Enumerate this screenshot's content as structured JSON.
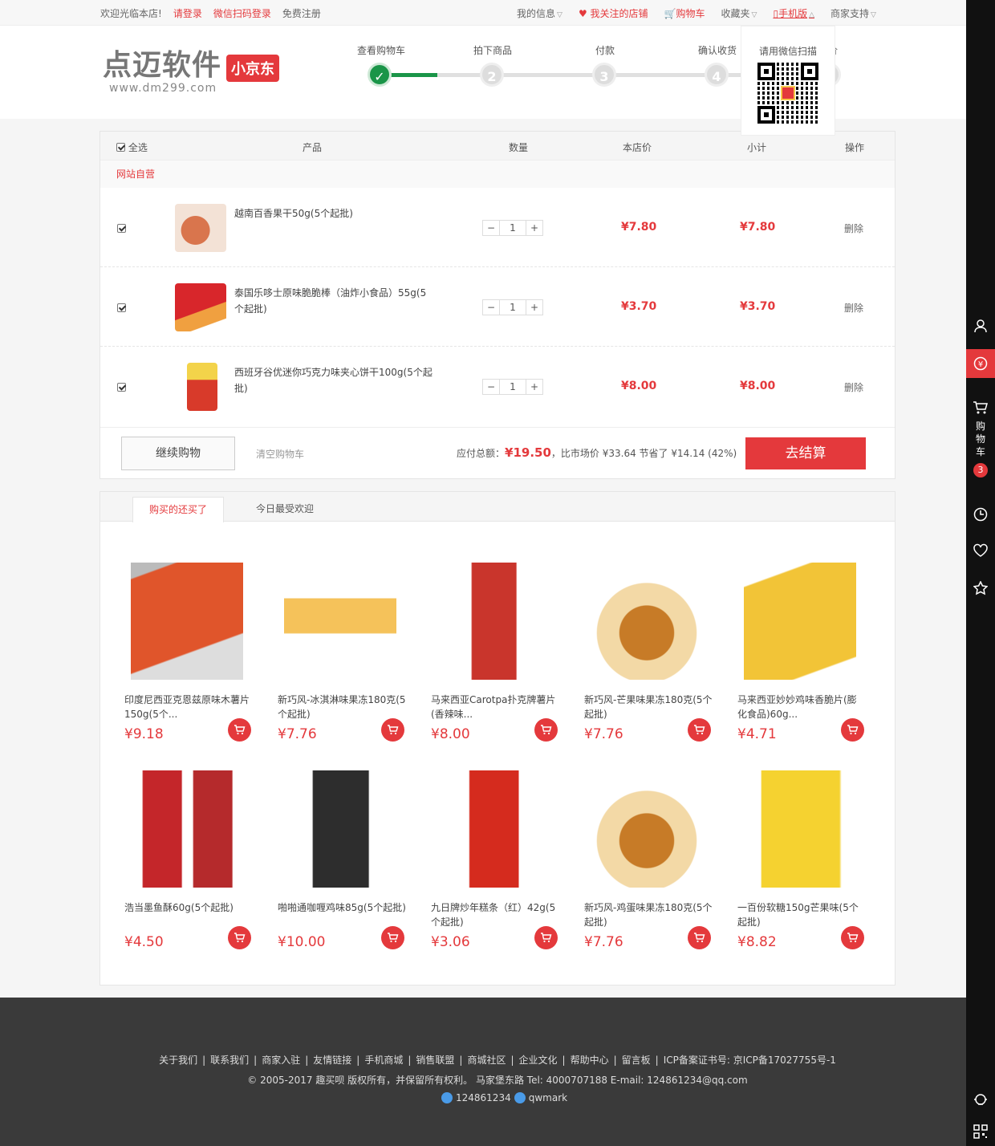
{
  "topbar": {
    "welcome": "欢迎光临本店!",
    "login": "请登录",
    "wechat_login": "微信扫码登录",
    "register": "免费注册",
    "my_info": "我的信息",
    "followed_shops": "我关注的店铺",
    "cart": "购物车",
    "favorites": "收藏夹",
    "mobile": "手机版",
    "merchant_support": "商家支持"
  },
  "logo": {
    "main": "点迈软件",
    "url": "www.dm299.com",
    "badge": "小京东"
  },
  "steps": [
    {
      "label": "查看购物车",
      "num": "✓",
      "done": true
    },
    {
      "label": "拍下商品",
      "num": "2",
      "done": false
    },
    {
      "label": "付款",
      "num": "3",
      "done": false
    },
    {
      "label": "确认收货",
      "num": "4",
      "done": false
    },
    {
      "label": "评价",
      "num": "5",
      "done": false
    }
  ],
  "qr_popup": {
    "title": "请用微信扫描"
  },
  "cart": {
    "headers": {
      "select_all": "全选",
      "product": "产品",
      "qty": "数量",
      "price": "本店价",
      "subtotal": "小计",
      "op": "操作"
    },
    "shop_name": "网站自营",
    "items": [
      {
        "name": "越南百香果干50g(5个起批)",
        "qty": "1",
        "price": "¥7.80",
        "subtotal": "¥7.80",
        "op": "删除"
      },
      {
        "name": "泰国乐哆士原味脆脆棒（油炸小食品）55g(5个起批)",
        "qty": "1",
        "price": "¥3.70",
        "subtotal": "¥3.70",
        "op": "删除"
      },
      {
        "name": "西班牙谷优迷你巧克力味夹心饼干100g(5个起批)",
        "qty": "1",
        "price": "¥8.00",
        "subtotal": "¥8.00",
        "op": "删除"
      }
    ],
    "continue_btn": "继续购物",
    "clear_btn": "清空购物车",
    "total_label": "应付总额：",
    "total_value": "¥19.50",
    "compare_text": "，比市场价 ¥33.64 节省了 ¥14.14 (42%)",
    "checkout_btn": "去结算"
  },
  "recommend": {
    "tabs": [
      "购买的还买了",
      "今日最受欢迎"
    ],
    "items": [
      {
        "name": "印度尼西亚克恩兹原味木薯片150g(5个...",
        "price": "¥9.18"
      },
      {
        "name": "新巧风-冰淇淋味果冻180克(5个起批)",
        "price": "¥7.76"
      },
      {
        "name": "马来西亚Carotpa扑克牌薯片(香辣味...",
        "price": "¥8.00"
      },
      {
        "name": "新巧风-芒果味果冻180克(5个起批)",
        "price": "¥7.76"
      },
      {
        "name": "马来西亚妙妙鸡味香脆片(膨化食品)60g...",
        "price": "¥4.71"
      },
      {
        "name": "浩当墨鱼酥60g(5个起批)",
        "price": "¥4.50"
      },
      {
        "name": "啪啪通咖喱鸡味85g(5个起批)",
        "price": "¥10.00"
      },
      {
        "name": "九日牌炒年糕条（红）42g(5个起批)",
        "price": "¥3.06"
      },
      {
        "name": "新巧风-鸡蛋味果冻180克(5个起批)",
        "price": "¥7.76"
      },
      {
        "name": "一百份软糖150g芒果味(5个起批)",
        "price": "¥8.82"
      }
    ]
  },
  "footer": {
    "links": [
      "关于我们",
      "联系我们",
      "商家入驻",
      "友情链接",
      "手机商城",
      "销售联盟",
      "商城社区",
      "企业文化",
      "帮助中心",
      "留言板"
    ],
    "icp": "ICP备案证书号: 京ICP备17027755号-1",
    "copyright": "© 2005-2017 趣买呗 版权所有，并保留所有权利。 马家堡东路 Tel: 4000707188 E-mail: 124861234@qq.com",
    "qq1": "124861234",
    "qq2": "qwmark"
  },
  "sidebar": {
    "cart_label": "购物车",
    "cart_count": "3"
  },
  "colors": {
    "accent": "#e4393c",
    "success": "#1a9548",
    "sidebar": "#111111",
    "footer": "#3a3a3a"
  }
}
